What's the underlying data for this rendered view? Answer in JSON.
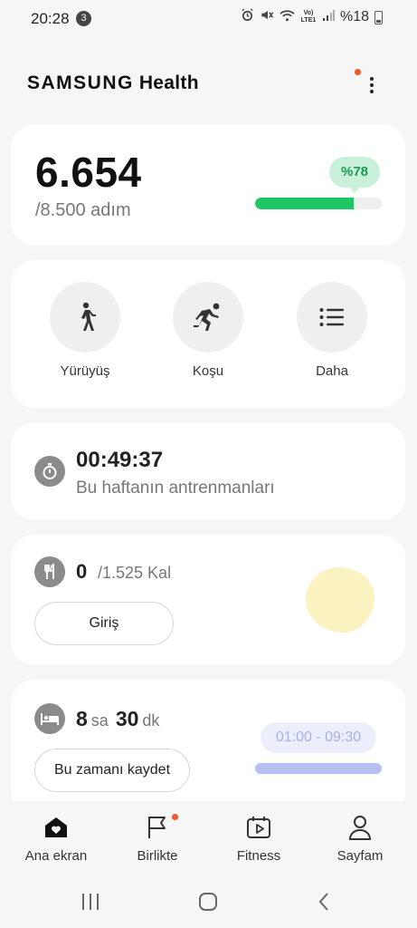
{
  "status_bar": {
    "time": "20:28",
    "notification_count": "3",
    "network": "Vo) LTE1",
    "battery": "%18"
  },
  "header": {
    "brand": "SAMSUNG",
    "app": "Health"
  },
  "steps": {
    "value": "6.654",
    "goal": "/8.500 adım",
    "percent_label": "%78",
    "progress": 0.78
  },
  "workouts": {
    "items": [
      {
        "label": "Yürüyüş",
        "icon": "walk-icon"
      },
      {
        "label": "Koşu",
        "icon": "run-icon"
      },
      {
        "label": "Daha",
        "icon": "list-icon"
      }
    ]
  },
  "exercise": {
    "time": "00:49:37",
    "subtitle": "Bu haftanın antrenmanları"
  },
  "food": {
    "value": "0",
    "goal": "/1.525 Kal",
    "button": "Giriş"
  },
  "sleep": {
    "hours": "8",
    "hours_unit": "sa",
    "minutes": "30",
    "minutes_unit": "dk",
    "button": "Bu zamanı kaydet",
    "range": "01:00 - 09:30"
  },
  "nav": {
    "items": [
      {
        "label": "Ana ekran",
        "icon": "home-icon"
      },
      {
        "label": "Birlikte",
        "icon": "flag-icon"
      },
      {
        "label": "Fitness",
        "icon": "fitness-icon"
      },
      {
        "label": "Sayfam",
        "icon": "person-icon"
      }
    ]
  },
  "colors": {
    "accent_green": "#1ec763",
    "badge_green_bg": "#c9f0d9",
    "notification_dot": "#f05a28",
    "sleep_bar": "#b8bff3"
  }
}
